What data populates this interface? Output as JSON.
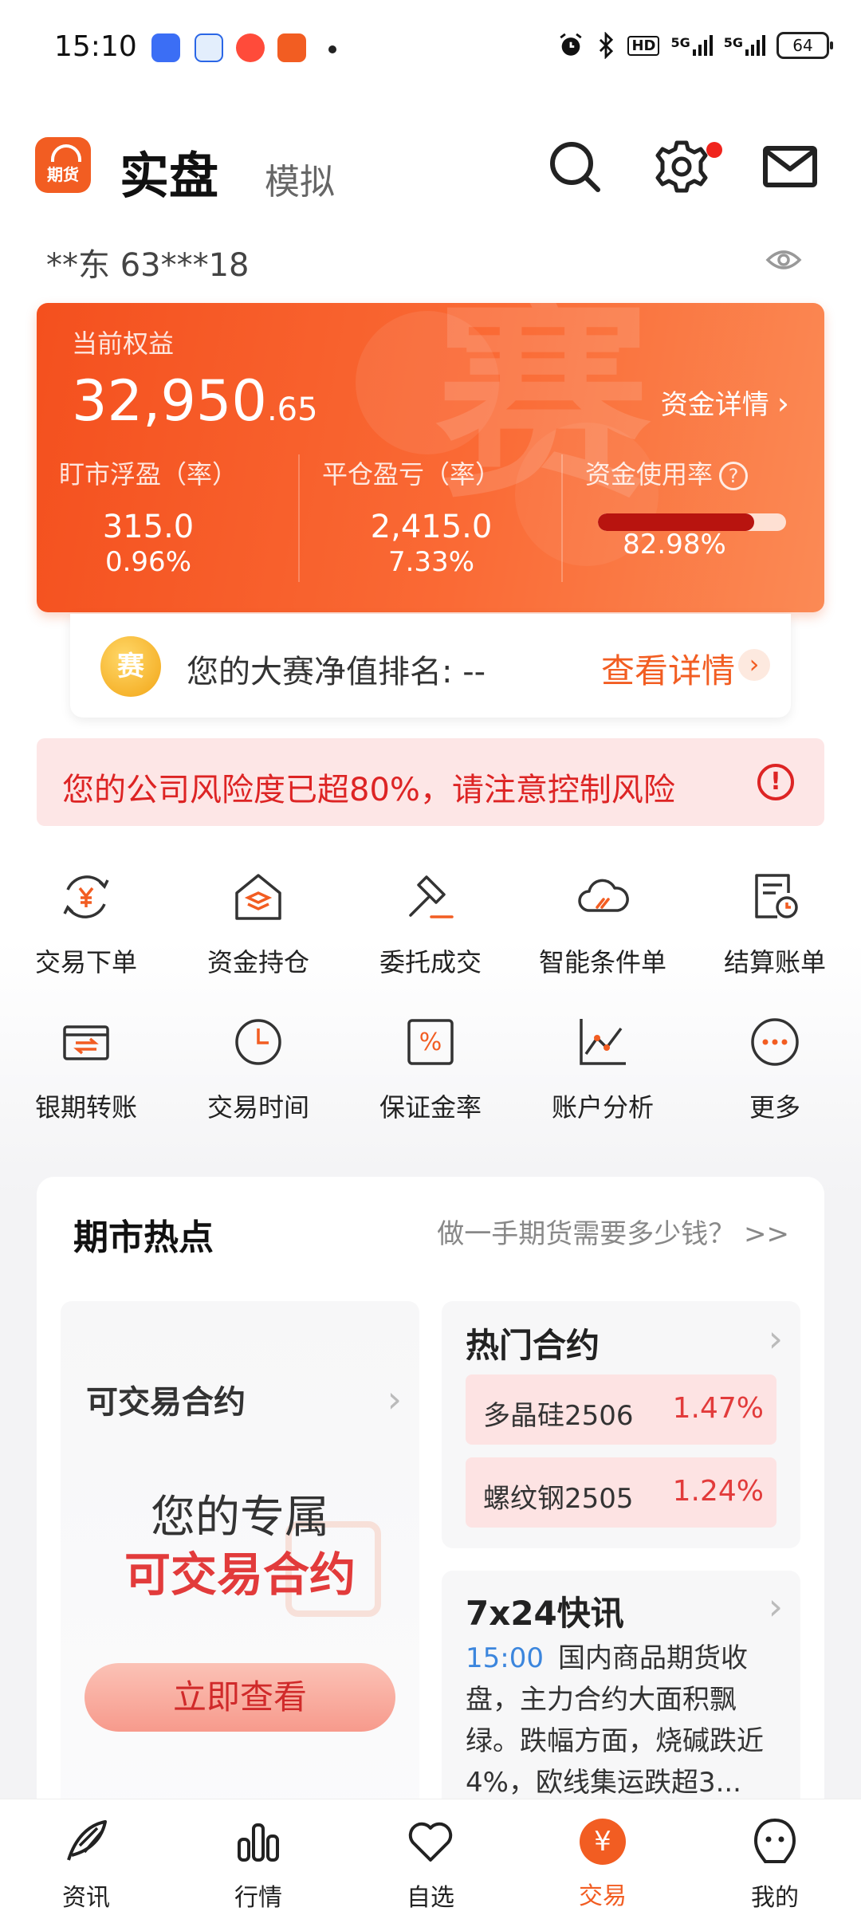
{
  "status_bar": {
    "time": "15:10",
    "network_labels": [
      "HD",
      "5G",
      "5G"
    ],
    "battery": "64"
  },
  "header": {
    "logo_text": "期货",
    "tab_real": "实盘",
    "tab_sim": "模拟"
  },
  "account": {
    "masked": "**东  63***18"
  },
  "equity": {
    "label": "当前权益",
    "value_int": "32,950",
    "value_dec": ".65",
    "detail_link": "资金详情",
    "floating_label": "盯市浮盈（率）",
    "floating_value": "315.0",
    "floating_rate": "0.96%",
    "close_label": "平仓盈亏（率）",
    "close_value": "2,415.0",
    "close_rate": "7.33%",
    "usage_label": "资金使用率",
    "usage_help": "?",
    "usage_rate": "82.98%",
    "usage_fraction": 0.83,
    "watermark": "赛"
  },
  "ranking": {
    "badge": "赛",
    "text": "您的大赛净值排名: --",
    "link": "查看详情",
    "chev": "›"
  },
  "risk": {
    "text": "您的公司风险度已超80%，请注意控制风险",
    "icon": "!"
  },
  "grid": [
    {
      "label": "交易下单",
      "icon": "yen-cycle-icon"
    },
    {
      "label": "资金持仓",
      "icon": "house-stack-icon"
    },
    {
      "label": "委托成交",
      "icon": "gavel-icon"
    },
    {
      "label": "智能条件单",
      "icon": "cloud-icon"
    },
    {
      "label": "结算账单",
      "icon": "bill-clock-icon"
    },
    {
      "label": "银期转账",
      "icon": "card-transfer-icon"
    },
    {
      "label": "交易时间",
      "icon": "clock-icon"
    },
    {
      "label": "保证金率",
      "icon": "percent-icon"
    },
    {
      "label": "账户分析",
      "icon": "line-chart-icon"
    },
    {
      "label": "更多",
      "icon": "more-icon"
    }
  ],
  "hot": {
    "title": "期市热点",
    "question": "做一手期货需要多少钱？ >>",
    "tradable": {
      "title": "可交易合约",
      "sub1": "您的专属",
      "sub2": "可交易合约",
      "button": "立即查看"
    },
    "contracts": {
      "title": "热门合约",
      "items": [
        {
          "name": "多晶硅2506",
          "pct": "1.47%"
        },
        {
          "name": "螺纹钢2505",
          "pct": "1.24%"
        }
      ]
    },
    "news": {
      "title": "7x24快讯",
      "time": "15:00",
      "text": "国内商品期货收盘，主力合约大面积飘绿。跌幅方面，烧碱跌近4%，欧线集运跌超3..."
    }
  },
  "colors": {
    "accent": "#f25d22",
    "danger": "#dd2424"
  },
  "bottom_nav": [
    {
      "label": "资讯",
      "icon": "feather-icon"
    },
    {
      "label": "行情",
      "icon": "bar-chart-icon"
    },
    {
      "label": "自选",
      "icon": "heart-icon"
    },
    {
      "label": "交易",
      "icon": "yen-circle-icon",
      "active": true,
      "glyph": "¥"
    },
    {
      "label": "我的",
      "icon": "smiley-icon"
    }
  ]
}
